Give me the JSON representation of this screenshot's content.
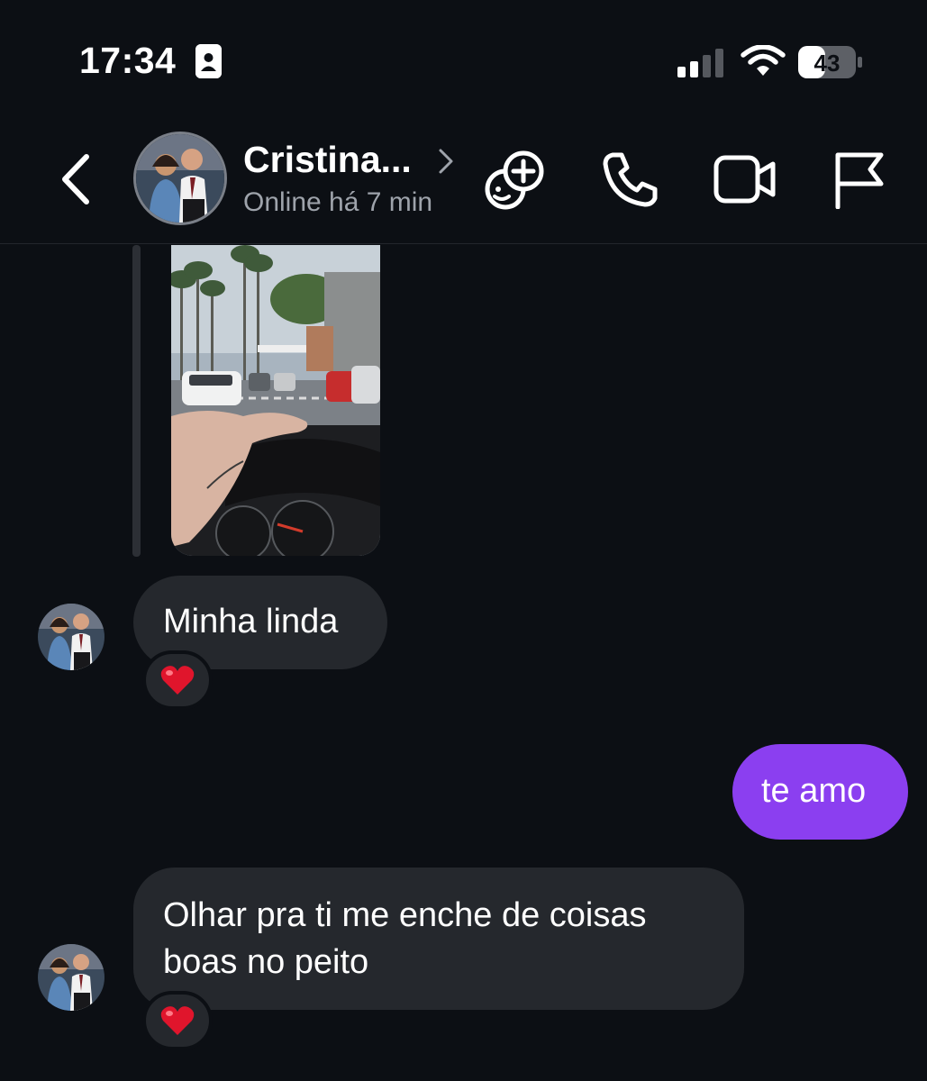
{
  "status_bar": {
    "time": "17:34",
    "battery_level": "43",
    "signal_bars_active": 2,
    "signal_bars_total": 4
  },
  "header": {
    "contact_name": "Cristina...",
    "contact_status": "Online há 7 min",
    "icons": [
      "back-icon",
      "effects-icon",
      "phone-icon",
      "video-icon",
      "flag-icon"
    ]
  },
  "messages": [
    {
      "direction": "incoming",
      "type": "image",
      "reply_indicator": true
    },
    {
      "direction": "incoming",
      "type": "text",
      "text": "Minha linda",
      "reaction": "❤️"
    },
    {
      "direction": "outgoing",
      "type": "text",
      "text": "te amo"
    },
    {
      "direction": "incoming",
      "type": "text",
      "lines": [
        "Olhar pra ti me enche de coisas",
        "boas no peito"
      ],
      "reaction": "❤️"
    }
  ],
  "colors": {
    "background": "#0c0f14",
    "incoming_bubble": "#25282d",
    "outgoing_bubble": "#8b3ff0",
    "secondary_text": "#9ea3ab"
  }
}
